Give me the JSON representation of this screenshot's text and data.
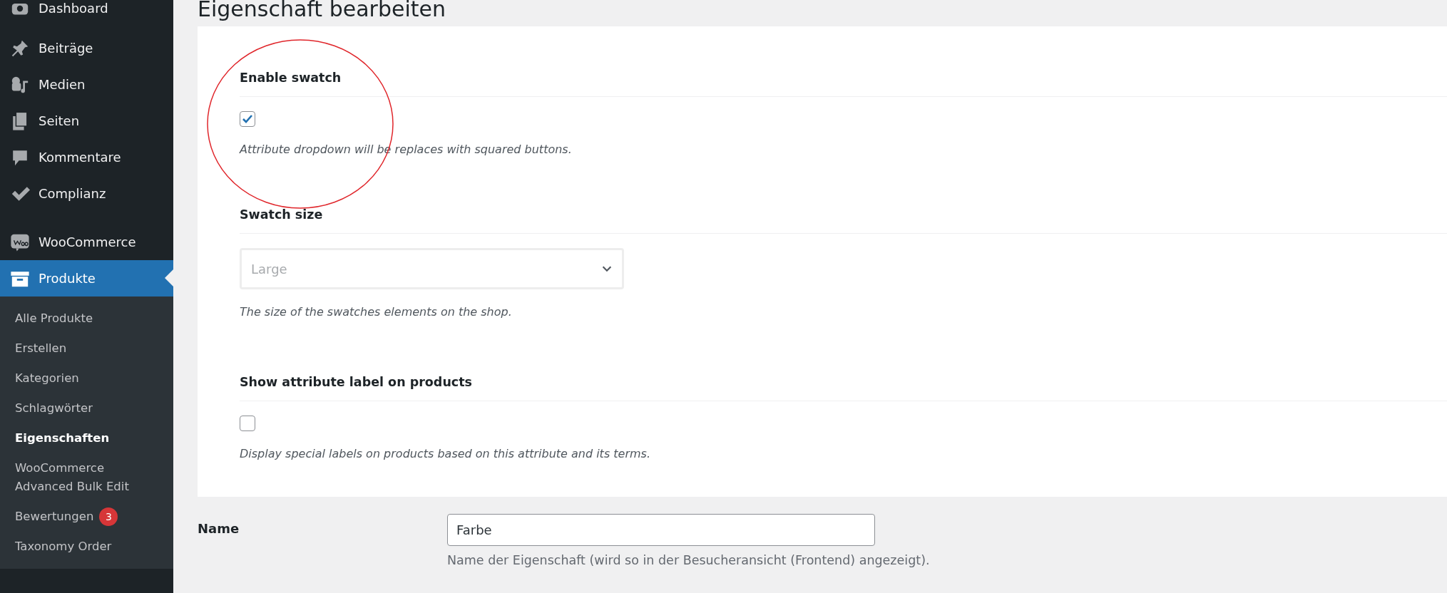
{
  "sidebar": {
    "groups": [
      [
        {
          "label": "Dashboard",
          "selected": false
        }
      ],
      [
        {
          "label": "Beiträge",
          "selected": false
        },
        {
          "label": "Medien",
          "selected": false
        },
        {
          "label": "Seiten",
          "selected": false
        },
        {
          "label": "Kommentare",
          "selected": false
        },
        {
          "label": "Complianz",
          "selected": false
        }
      ],
      [
        {
          "label": "WooCommerce",
          "selected": false
        },
        {
          "label": "Produkte",
          "selected": true,
          "children": [
            {
              "label": "Alle Produkte",
              "selected": false
            },
            {
              "label": "Erstellen",
              "selected": false
            },
            {
              "label": "Kategorien",
              "selected": false
            },
            {
              "label": "Schlagwörter",
              "selected": false
            },
            {
              "label": "Eigenschaften",
              "selected": true
            },
            {
              "label": "WooCommerce Advanced Bulk Edit",
              "selected": false
            },
            {
              "label": "Bewertungen",
              "selected": false,
              "badge": "3"
            },
            {
              "label": "Taxonomy Order",
              "selected": false
            }
          ]
        }
      ]
    ]
  },
  "page_title": "Eigenschaft bearbeiten",
  "annotation_circle": true,
  "settings": [
    {
      "kind": "checkbox",
      "label": "Enable swatch",
      "checked": true,
      "description": "Attribute dropdown will be replaces with squared buttons."
    },
    {
      "kind": "select",
      "label": "Swatch size",
      "value": "Large",
      "description": "The size of the swatches elements on the shop."
    },
    {
      "kind": "checkbox",
      "label": "Show attribute label on products",
      "checked": false,
      "description": "Display special labels on products based on this attribute and its terms."
    }
  ],
  "name_field": {
    "label": "Name",
    "value": "Farbe",
    "help": "Name der Eigenschaft (wird so in der Besucheransicht (Frontend) angezeigt)."
  }
}
